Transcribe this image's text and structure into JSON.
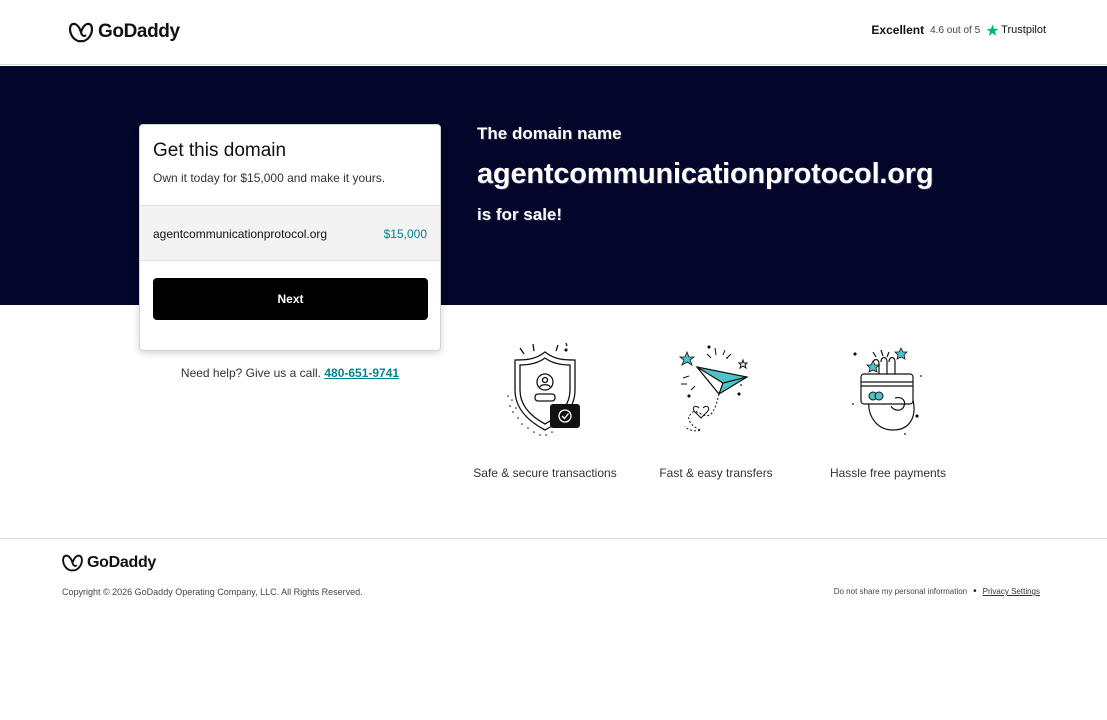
{
  "header": {
    "brand": "GoDaddy",
    "trust_excellent": "Excellent",
    "trust_rating": "4.6 out of 5",
    "trust_brand": "Trustpilot"
  },
  "hero": {
    "line1": "The domain name",
    "domain": "agentcommunicationprotocol.org",
    "line3": "is for sale!"
  },
  "card": {
    "title": "Get this domain",
    "subtitle": "Own it today for $15,000 and make it yours.",
    "domain": "agentcommunicationprotocol.org",
    "price": "$15,000",
    "next_label": "Next"
  },
  "help": {
    "text": "Need help? Give us a call.",
    "phone": "480-651-9741"
  },
  "features": [
    {
      "label": "Safe & secure transactions",
      "icon": "shield-icon"
    },
    {
      "label": "Fast & easy transfers",
      "icon": "paper-plane-icon"
    },
    {
      "label": "Hassle free payments",
      "icon": "payment-card-icon"
    }
  ],
  "footer": {
    "brand": "GoDaddy",
    "copyright": "Copyright © 2026 GoDaddy Operating Company, LLC. All Rights Reserved.",
    "do_not_share": "Do not share my personal information",
    "separator": "•",
    "privacy": "Privacy Settings"
  },
  "colors": {
    "hero_bg": "#03052b",
    "accent_teal": "#00838c",
    "trustpilot_green": "#00b67a",
    "button_bg": "#000000"
  }
}
